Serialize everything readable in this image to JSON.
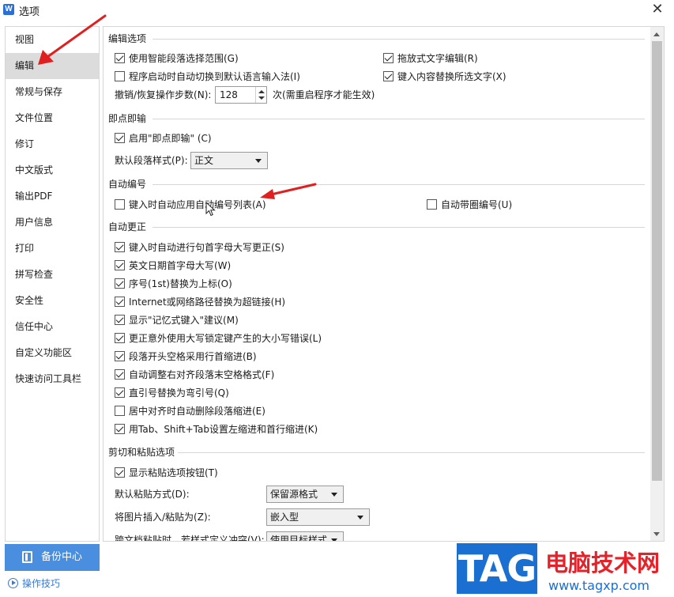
{
  "window": {
    "title": "选项",
    "app_icon": "W"
  },
  "sidebar": {
    "items": [
      {
        "label": "视图"
      },
      {
        "label": "编辑",
        "active": true
      },
      {
        "label": "常规与保存"
      },
      {
        "label": "文件位置"
      },
      {
        "label": "修订"
      },
      {
        "label": "中文版式"
      },
      {
        "label": "输出PDF"
      },
      {
        "label": "用户信息"
      },
      {
        "label": "打印"
      },
      {
        "label": "拼写检查"
      },
      {
        "label": "安全性"
      },
      {
        "label": "信任中心"
      },
      {
        "label": "自定义功能区"
      },
      {
        "label": "快速访问工具栏"
      }
    ],
    "backup_label": "备份中心",
    "tips_label": "操作技巧"
  },
  "edit_options": {
    "title": "编辑选项",
    "smart_select": {
      "label": "使用智能段落选择范围(G)",
      "checked": true
    },
    "drag_drop": {
      "label": "拖放式文字编辑(R)",
      "checked": true
    },
    "auto_ime": {
      "label": "程序启动时自动切换到默认语言输入法(I)",
      "checked": false
    },
    "typing_replaces": {
      "label": "键入内容替换所选文字(X)",
      "checked": true
    },
    "undo_label": "撤销/恢复操作步数(N):",
    "undo_value": "128",
    "undo_note": "次(需重启程序才能生效)"
  },
  "click_type": {
    "title": "即点即输",
    "enable": {
      "label": "启用\"即点即输\" (C)",
      "checked": true
    },
    "default_style_label": "默认段落样式(P):",
    "default_style_value": "正文"
  },
  "auto_numbering": {
    "title": "自动编号",
    "auto_list": {
      "label": "键入时自动应用自动编号列表(A)",
      "checked": false
    },
    "auto_circle": {
      "label": "自动带圈编号(U)",
      "checked": false
    }
  },
  "autocorrect": {
    "title": "自动更正",
    "items": [
      {
        "label": "键入时自动进行句首字母大写更正(S)",
        "checked": true
      },
      {
        "label": "英文日期首字母大写(W)",
        "checked": true
      },
      {
        "label": "序号(1st)替换为上标(O)",
        "checked": true
      },
      {
        "label": "Internet或网络路径替换为超链接(H)",
        "checked": true
      },
      {
        "label": "显示\"记忆式键入\"建议(M)",
        "checked": true
      },
      {
        "label": "更正意外使用大写锁定键产生的大小写错误(L)",
        "checked": true
      },
      {
        "label": "段落开头空格采用行首缩进(B)",
        "checked": true
      },
      {
        "label": "自动调整右对齐段落末空格格式(F)",
        "checked": true
      },
      {
        "label": "直引号替换为弯引号(Q)",
        "checked": true
      },
      {
        "label": "居中对齐时自动删除段落缩进(E)",
        "checked": false
      },
      {
        "label": "用Tab、Shift+Tab设置左缩进和首行缩进(K)",
        "checked": true
      }
    ]
  },
  "cut_paste": {
    "title": "剪切和粘贴选项",
    "show_paste_btn": {
      "label": "显示粘贴选项按钮(T)",
      "checked": true
    },
    "default_paste_label": "默认粘贴方式(D):",
    "default_paste_value": "保留源格式",
    "insert_image_label": "将图片插入/粘贴为(Z):",
    "insert_image_value": "嵌入型",
    "cross_doc_label": "跨文档粘贴时，若样式定义冲突(V):",
    "cross_doc_value": "使用目标样式"
  },
  "watermark": {
    "tag": "TAG",
    "title": "电脑技术网",
    "url": "www.tagxp.com"
  },
  "colors": {
    "accent": "#4a8ee0",
    "arrow": "#e02020",
    "watermark_red": "#e5222a",
    "watermark_blue": "#1a6fd0"
  }
}
